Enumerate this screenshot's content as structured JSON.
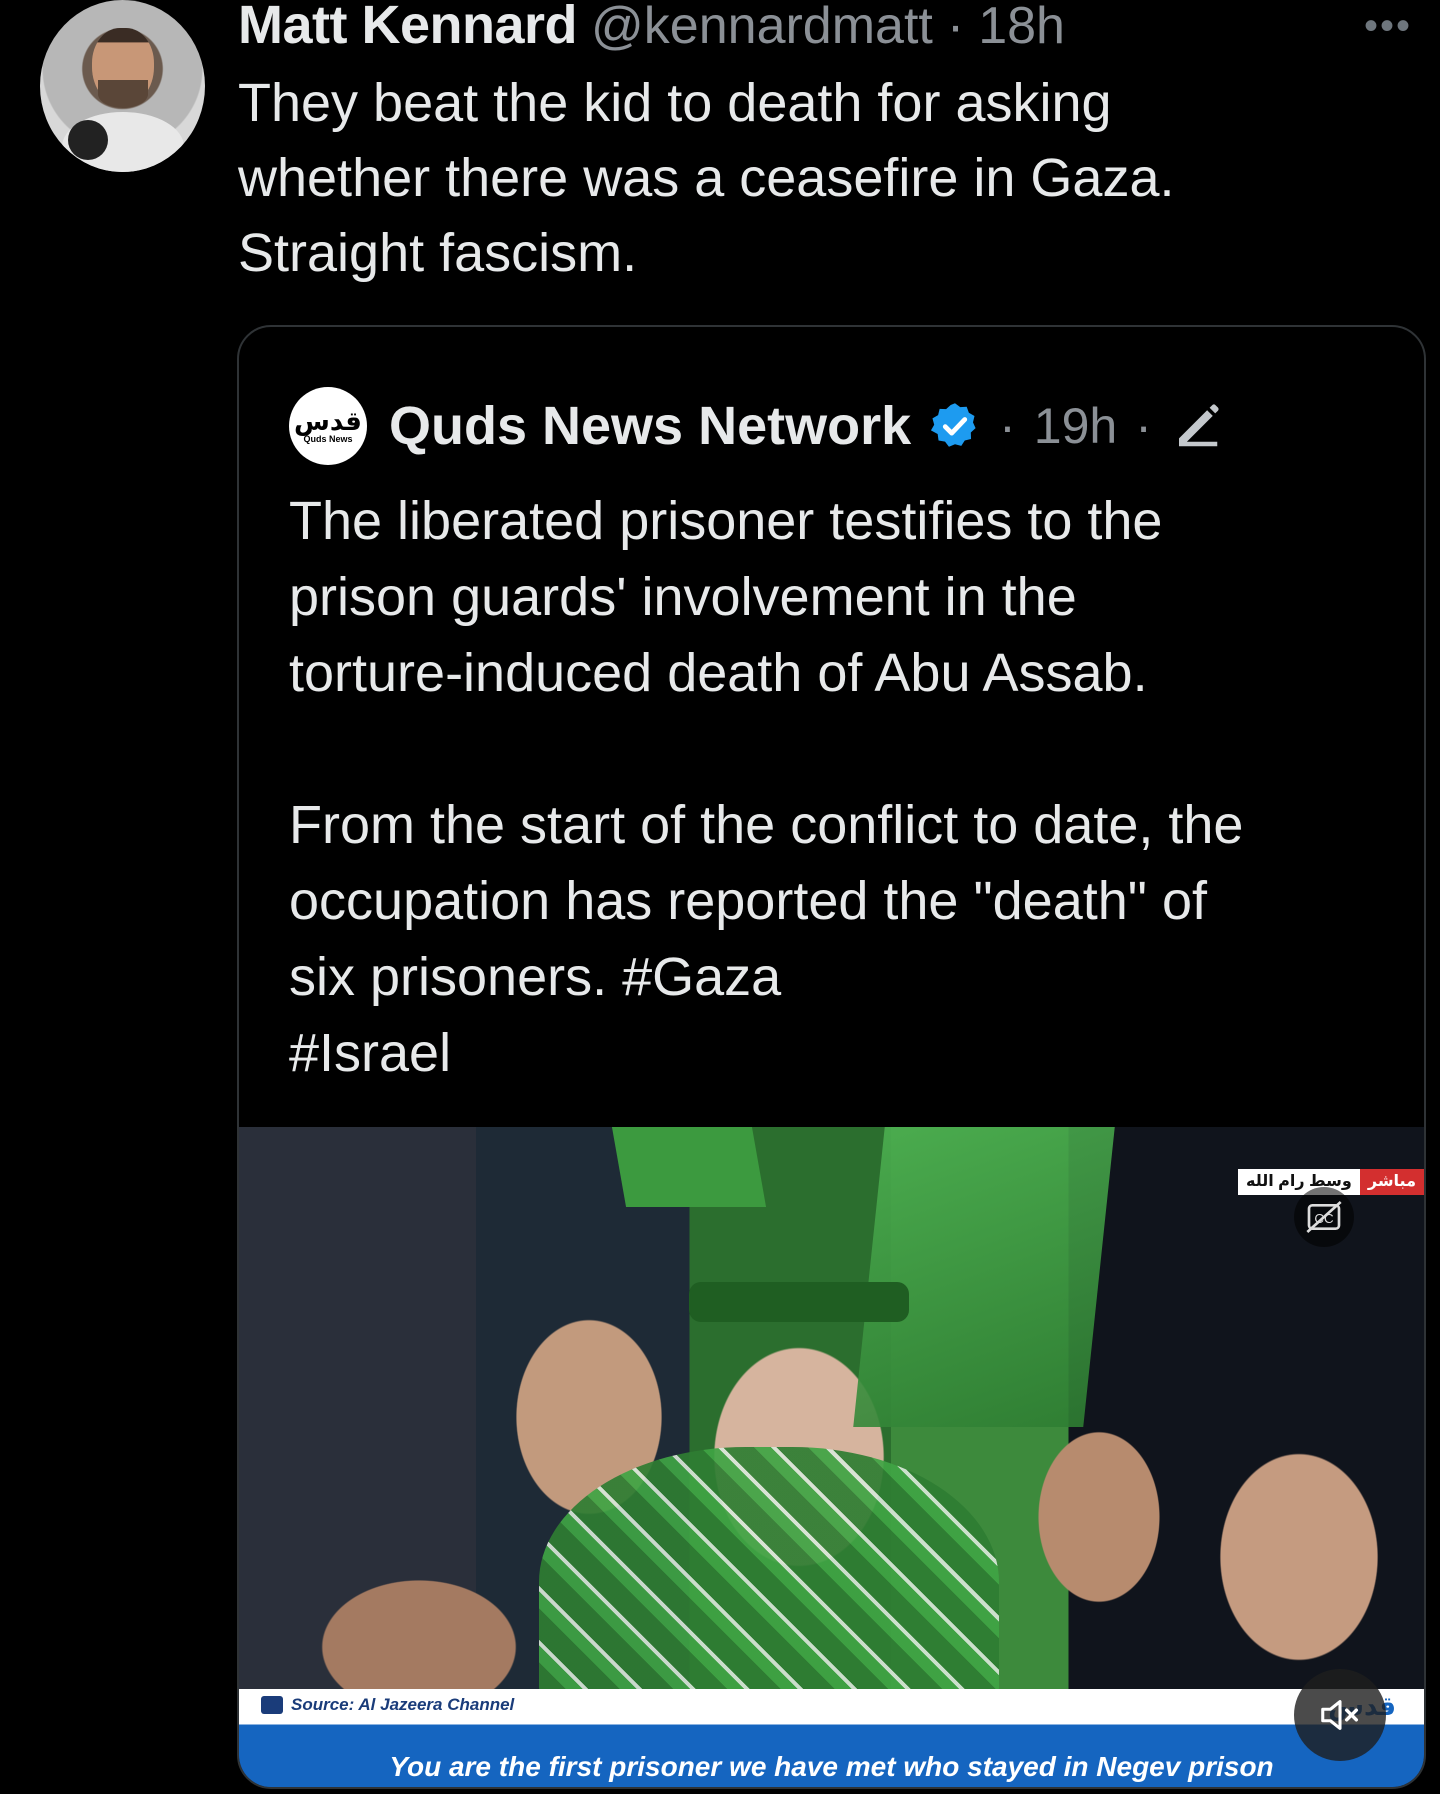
{
  "tweet": {
    "author_name": "Matt Kennard",
    "author_handle": "@kennardmatt",
    "separator": "·",
    "time": "18h",
    "more_label": "•••",
    "text": "They beat the kid to death for asking\nwhether there was a ceasefire in Gaza.\nStraight fascism."
  },
  "quote": {
    "logo_arabic": "قدس",
    "logo_english": "Quds News",
    "author_name": "Quds News Network",
    "meta_separator": "·",
    "time": "19h",
    "text": "The liberated prisoner testifies to the\nprison guards' involvement in the\ntorture-induced death of Abu Assab.\n\nFrom the start of the conflict to date, the\noccupation has reported the \"death\" of\nsix prisoners. #Gaza\n#Israel"
  },
  "media": {
    "live_location": "وسط رام الله",
    "live_label": "مباشر",
    "source_label": "Source: Al Jazeera Channel",
    "caption": "You are the first prisoner we have met who stayed in Negev prison",
    "brand": "قدس"
  },
  "colors": {
    "background": "#000000",
    "text_primary": "#e7e9ea",
    "text_secondary": "#8b9096",
    "border": "#2f3336",
    "verified": "#1d9bf0"
  },
  "icons": {
    "verified": "verified-badge-icon",
    "edit": "edit-pencil-icon",
    "captions": "closed-captions-icon",
    "mute": "speaker-muted-icon",
    "more": "more-dots-icon"
  }
}
